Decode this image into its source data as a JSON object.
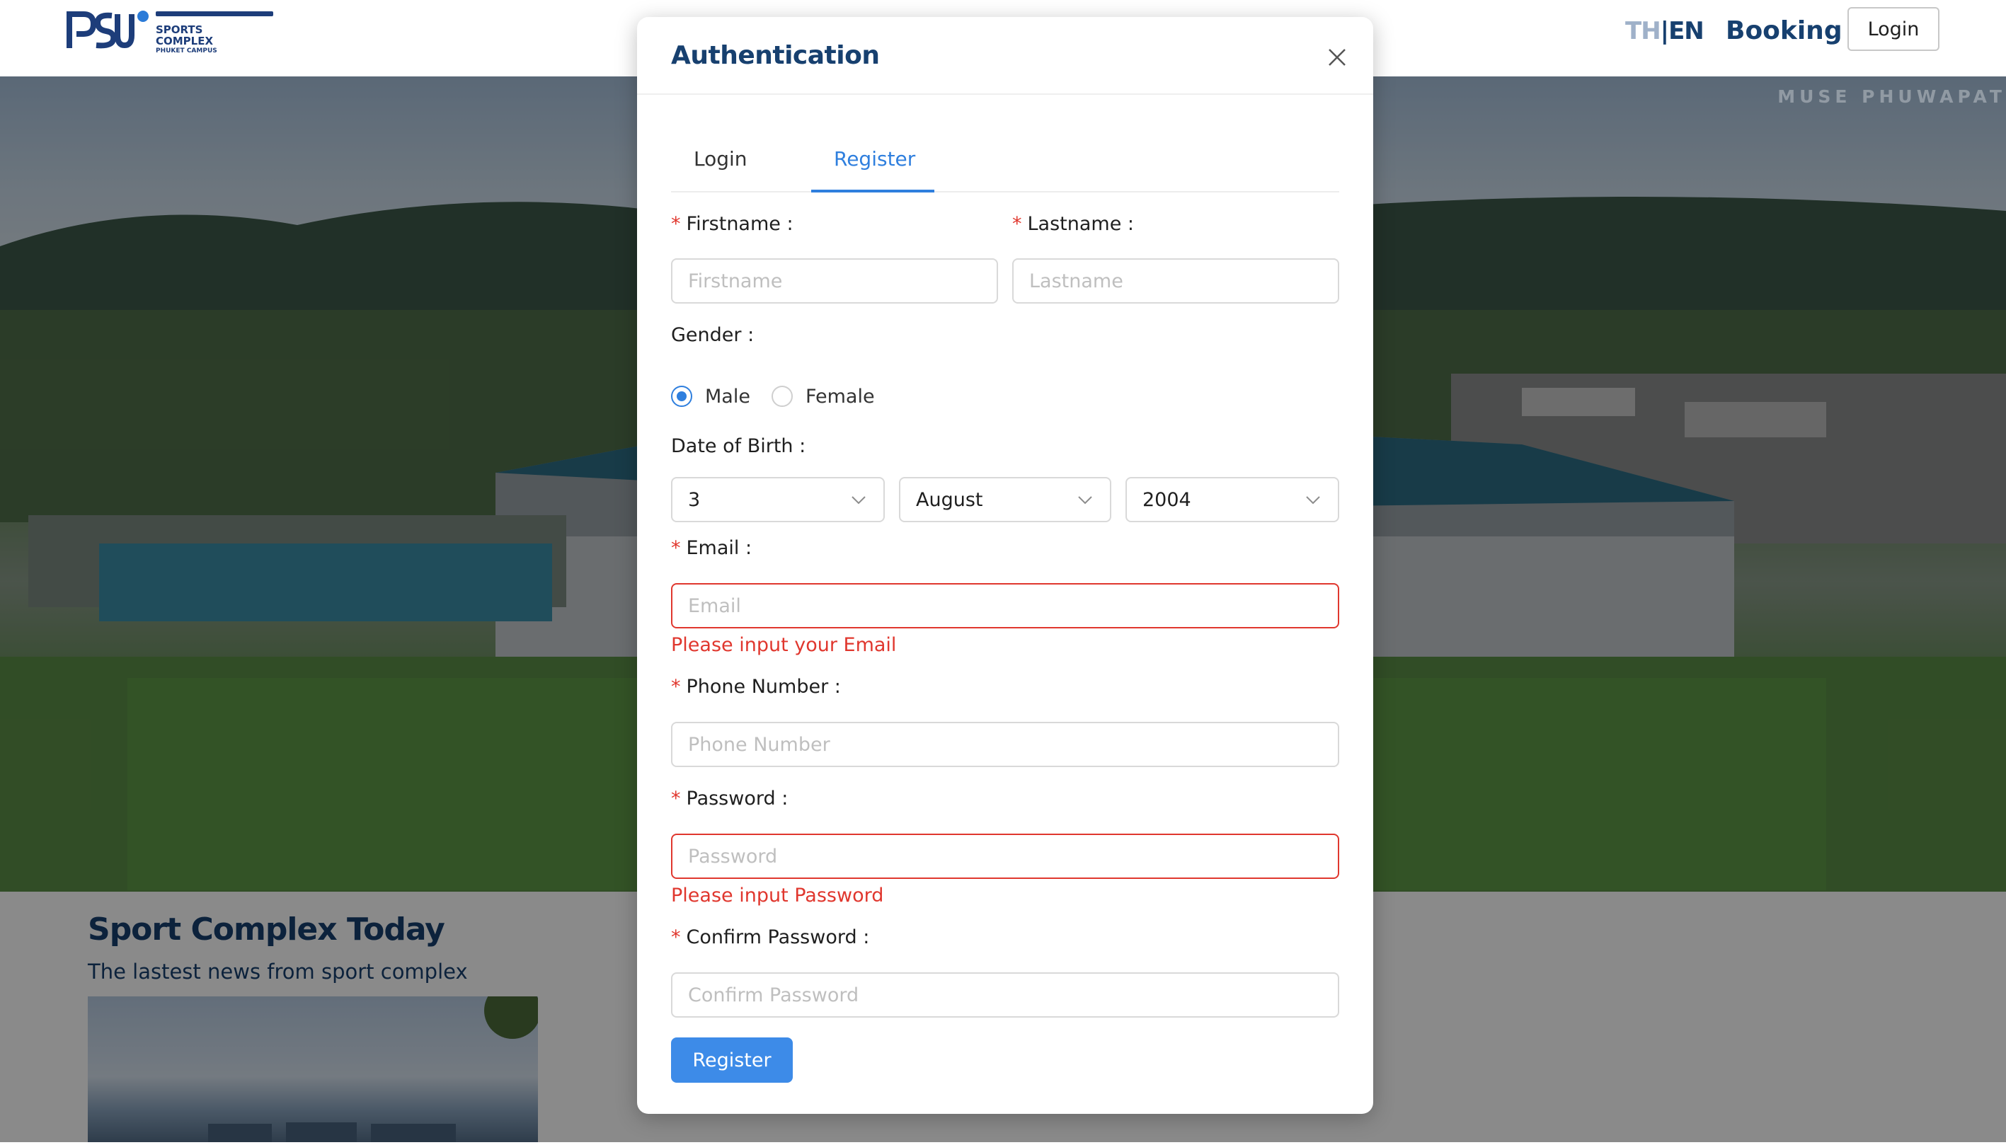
{
  "header": {
    "logo": {
      "text_1": "SPORTS",
      "text_2": "COMPLEX",
      "text_3": "PHUKET CAMPUS",
      "mark": "PSU"
    },
    "lang": {
      "th": "TH",
      "separator": "|",
      "en": "EN"
    },
    "booking_label": "Booking",
    "login_label": "Login"
  },
  "hero": {
    "watermark": "MUSE PHUWAPAT"
  },
  "news": {
    "title": "Sport Complex Today",
    "subtitle": "The lastest news from sport complex"
  },
  "modal": {
    "title": "Authentication",
    "tabs": [
      {
        "label": "Login",
        "active": false
      },
      {
        "label": "Register",
        "active": true
      }
    ],
    "firstname": {
      "label": "Firstname",
      "colon": ":",
      "placeholder": "Firstname",
      "value": "",
      "required": true
    },
    "lastname": {
      "label": "Lastname",
      "colon": ":",
      "placeholder": "Lastname",
      "value": "",
      "required": true
    },
    "gender": {
      "label": "Gender",
      "colon": ":",
      "options": [
        {
          "label": "Male",
          "selected": true
        },
        {
          "label": "Female",
          "selected": false
        }
      ]
    },
    "dob": {
      "label": "Date of Birth",
      "colon": ":",
      "day": "3",
      "month": "August",
      "year": "2004"
    },
    "email": {
      "label": "Email",
      "colon": ":",
      "placeholder": "Email",
      "value": "",
      "required": true,
      "error": "Please input your Email"
    },
    "phone": {
      "label": "Phone Number",
      "colon": ":",
      "placeholder": "Phone Number",
      "value": "",
      "required": true
    },
    "password": {
      "label": "Password",
      "colon": ":",
      "placeholder": "Password",
      "value": "",
      "required": true,
      "error": "Please input Password"
    },
    "confirm_password": {
      "label": "Confirm Password",
      "colon": ":",
      "placeholder": "Confirm Password",
      "value": "",
      "required": true
    },
    "required_mark": "*",
    "register_button": "Register"
  },
  "colors": {
    "brand_navy": "#17406f",
    "accent_blue": "#2f7fde",
    "error_red": "#e0372e"
  },
  "icons": {
    "close": "close-icon",
    "chevron": "chevron-down-icon",
    "radio": "radio-button"
  }
}
